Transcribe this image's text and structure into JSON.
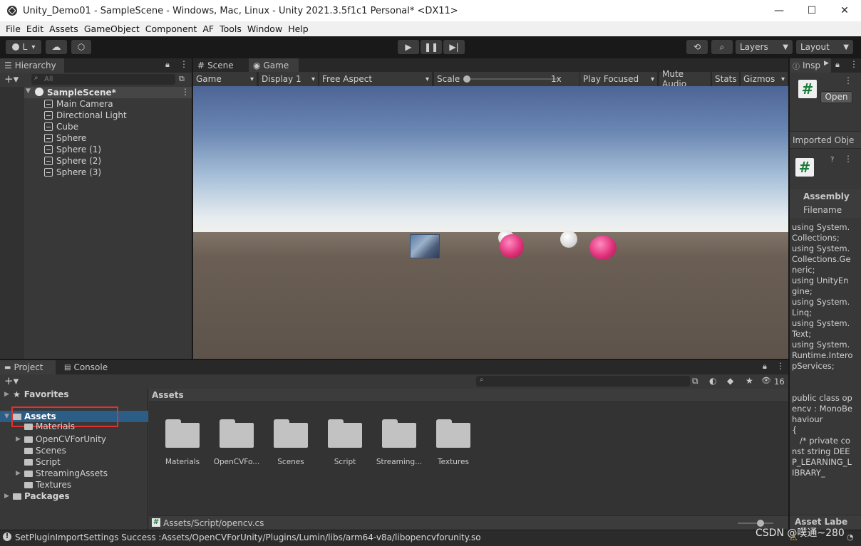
{
  "window": {
    "title": "Unity_Demo01 - SampleScene - Windows, Mac, Linux - Unity 2021.3.5f1c1 Personal* <DX11>",
    "controls": [
      "—",
      "☐",
      "✕"
    ],
    "menu_dots": "⋮"
  },
  "menu": [
    "File",
    "Edit",
    "Assets",
    "GameObject",
    "Component",
    "AF",
    "Tools",
    "Window",
    "Help"
  ],
  "toolbar": {
    "account_label": "L",
    "layers_label": "Layers",
    "layout_label": "Layout"
  },
  "hierarchy": {
    "tab_label": "Hierarchy",
    "search_placeholder": "All",
    "scene_name": "SampleScene*",
    "items": [
      "Main Camera",
      "Directional Light",
      "Cube",
      "Sphere",
      "Sphere (1)",
      "Sphere (2)",
      "Sphere (3)"
    ]
  },
  "center_tabs": {
    "scene": "Scene",
    "game": "Game"
  },
  "game_bar": {
    "mode": "Game",
    "display": "Display 1",
    "aspect": "Free Aspect",
    "scale_label": "Scale",
    "scale_value": "1x",
    "play_mode": "Play Focused",
    "mute": "Mute Audio",
    "stats": "Stats",
    "gizmos": "Gizmos"
  },
  "inspector": {
    "tab_label": "Insp",
    "open_button": "Open",
    "imported_label": "Imported Obje",
    "assembly_label": "Assembly",
    "filename_label": "Filename",
    "code": "using System.Collections;\nusing System.Collections.Generic;\nusing UnityEngine;\nusing System.Linq;\nusing System.Text;\nusing System.Runtime.InteropServices;\n\n\npublic class opencv : MonoBehaviour\n{\n   /* private const string DEEP_LEARNING_LIBRARY_",
    "asset_labels": "Asset Labe"
  },
  "project": {
    "tab_project": "Project",
    "tab_console": "Console",
    "hidden_count": "16",
    "favorites": "Favorites",
    "assets_root": "Assets",
    "tree": [
      {
        "label": "Materials",
        "expandable": false
      },
      {
        "label": "OpenCVForUnity",
        "expandable": true
      },
      {
        "label": "Scenes",
        "expandable": false
      },
      {
        "label": "Script",
        "expandable": false
      },
      {
        "label": "StreamingAssets",
        "expandable": true
      },
      {
        "label": "Textures",
        "expandable": false
      }
    ],
    "packages": "Packages",
    "breadcrumb": "Assets",
    "folders": [
      "Materials",
      "OpenCVFo...",
      "Scenes",
      "Script",
      "Streaming...",
      "Textures"
    ],
    "selected_path": "Assets/Script/opencv.cs"
  },
  "status_bar": {
    "message": "SetPluginImportSettings Success :Assets/OpenCVForUnity/Plugins/Lumin/libs/arm64-v8a/libopencvforunity.so",
    "watermark": "CSDN @噗通~280"
  },
  "colors": {
    "highlight_box": "#e03131",
    "selected_row": "#2c5d87",
    "sphere_pink": "#e0307a"
  }
}
